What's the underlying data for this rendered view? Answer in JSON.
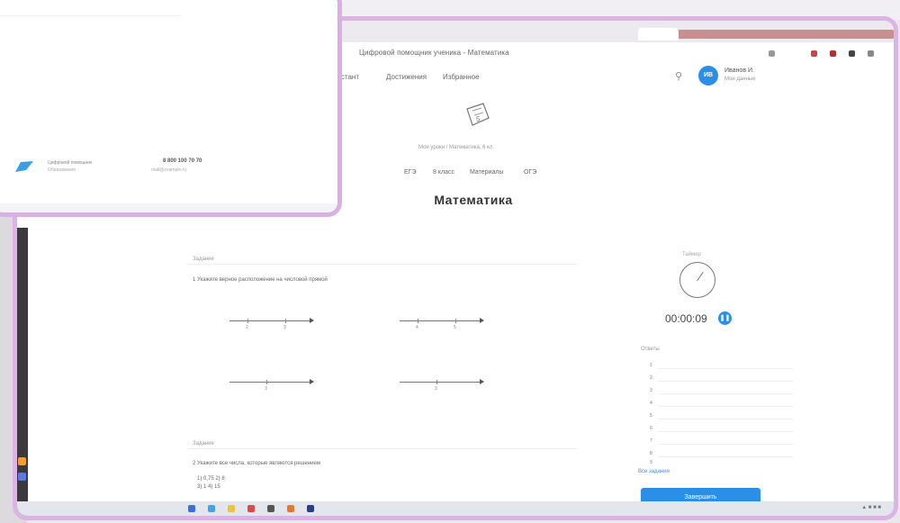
{
  "browser": {
    "address_text": "Цифровой помощник ученика - Математика",
    "search_icon": "search-icon",
    "colors": {
      "frame": "#dcb4e4",
      "accent": "#2b8fe8"
    }
  },
  "header": {
    "nav": [
      "Дистант",
      "Достижения",
      "Избранное"
    ],
    "user": {
      "initials": "ИВ",
      "name": "Иванов И.",
      "role": "Мои данные"
    }
  },
  "breadcrumb": "Мои уроки / Математика, 6 кл.",
  "subnav": [
    "ЕГЭ",
    "8 класс",
    "Материалы",
    "ОГЭ"
  ],
  "page_title": "Математика",
  "tasks": [
    {
      "header": "Задание",
      "text": "1 Укажите верное расположение на числовой прямой",
      "number_lines": [
        {
          "ticks": [
            "2",
            "3"
          ]
        },
        {
          "ticks": [
            "4",
            "5"
          ]
        },
        {
          "ticks": [
            "3"
          ]
        },
        {
          "ticks": [
            "3"
          ]
        }
      ]
    },
    {
      "header": "Задание",
      "text": "2 Укажите все числа, которые являются решением",
      "options": "1) 0,75  2) 8",
      "options2": "3) 1  4) 15"
    }
  ],
  "timer": {
    "caption": "Таймер",
    "value": "00:00:09",
    "button_icon": "pause-icon"
  },
  "answers": {
    "caption": "Ответы",
    "numbers": [
      "1",
      "2",
      "3",
      "4",
      "5",
      "6",
      "7",
      "8",
      "9"
    ]
  },
  "link_text": "Все задания",
  "submit_label": "Завершить",
  "overlay": {
    "line1": "Цифровой помощник",
    "line2": "Образование",
    "phone": "8 800 100 70 70",
    "email": "mail@example.ru"
  }
}
